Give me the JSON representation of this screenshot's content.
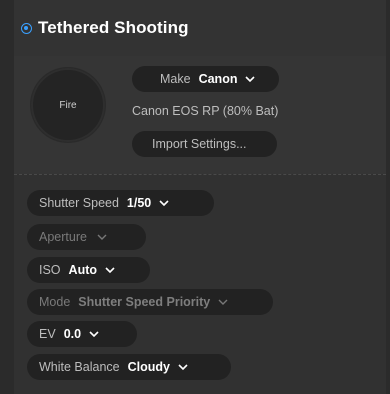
{
  "panel": {
    "title": "Tethered Shooting",
    "fire_label": "Fire",
    "make": {
      "label": "Make",
      "value": "Canon"
    },
    "camera_status": "Canon EOS RP (80% Bat)",
    "import_settings_label": "Import Settings..."
  },
  "settings": {
    "shutter_speed": {
      "label": "Shutter Speed",
      "value": "1/50"
    },
    "aperture": {
      "label": "Aperture",
      "value": ""
    },
    "iso": {
      "label": "ISO",
      "value": "Auto"
    },
    "mode": {
      "label": "Mode",
      "value": "Shutter Speed Priority"
    },
    "ev": {
      "label": "EV",
      "value": "0.0"
    },
    "white_balance": {
      "label": "White Balance",
      "value": "Cloudy"
    }
  },
  "colors": {
    "accent": "#3aa0ff",
    "panel_bg": "#303030",
    "pill_bg": "#222222"
  },
  "icons": {
    "dropdown": "chevron-down-icon",
    "active_indicator": "radio-on-icon"
  }
}
